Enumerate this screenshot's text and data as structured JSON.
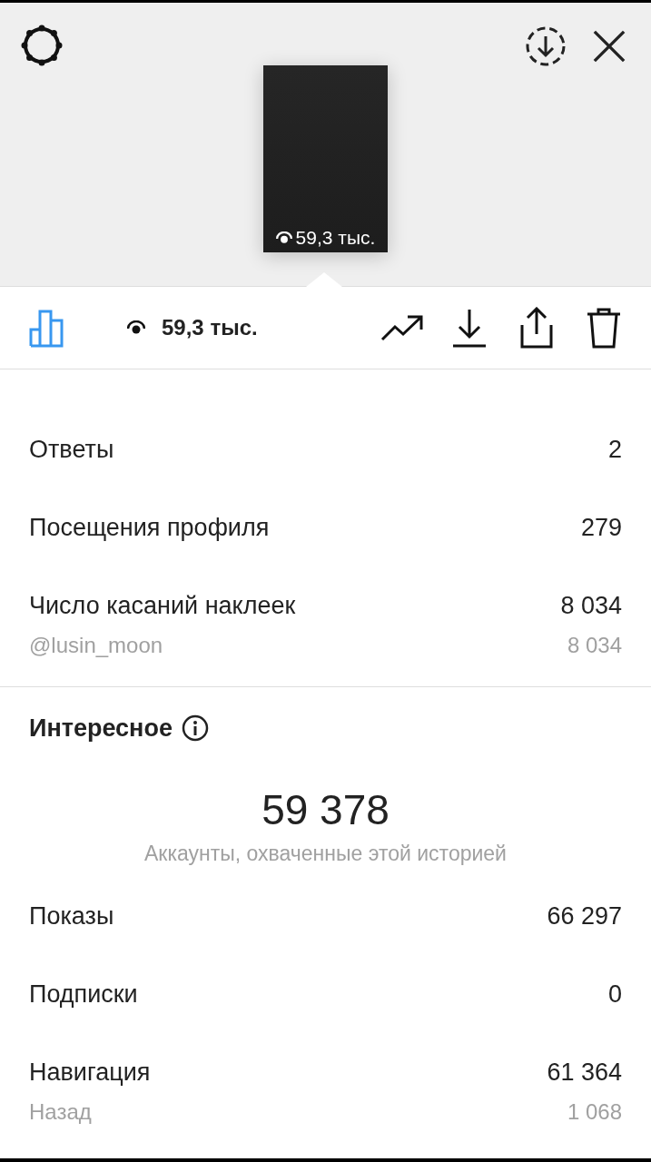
{
  "preview": {
    "views": "59,3 тыс."
  },
  "toolbar": {
    "insights_selected": true,
    "views": "59,3 тыс."
  },
  "interactions": [
    {
      "kind": "main",
      "label": "Ответы",
      "value": "2"
    },
    {
      "kind": "main",
      "label": "Посещения профиля",
      "value": "279"
    },
    {
      "kind": "main",
      "label": "Число касаний наклеек",
      "value": "8 034"
    },
    {
      "kind": "sub",
      "label": "@lusin_moon",
      "value": "8 034"
    }
  ],
  "discovery": {
    "title": "Интересное",
    "reach": "59 378",
    "reach_caption": "Аккаунты, охваченные этой историей",
    "rows": [
      {
        "kind": "main",
        "label": "Показы",
        "value": "66 297"
      },
      {
        "kind": "main",
        "label": "Подписки",
        "value": "0"
      },
      {
        "kind": "main",
        "label": "Навигация",
        "value": "61 364"
      },
      {
        "kind": "sub",
        "label": "Назад",
        "value": "1 068"
      }
    ]
  }
}
